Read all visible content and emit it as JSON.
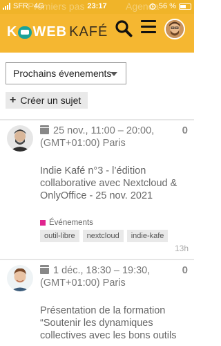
{
  "status_bar": {
    "carrier": "SFR",
    "network": "4G",
    "time": "23:17",
    "battery": "56 %",
    "battery_level": 0.56
  },
  "behind_tabs": [
    "Premiers pas",
    "Agenda"
  ],
  "header": {
    "logo_part1": "K",
    "logo_part2": "WEB",
    "logo_part3": "KAFÉ",
    "brand_color": "#f5b731"
  },
  "filter": {
    "selected": "Prochains évenements"
  },
  "create_button": {
    "label": "Créer un sujet"
  },
  "topics": [
    {
      "date": "25 nov., 11:00 – 20:00, (GMT+01:00) Paris",
      "replies": "0",
      "title": "Indie Kafé n°3 - l’édition collaborative avec Nextcloud & OnlyOffice - 25 nov. 2021",
      "category": "Événements",
      "category_color": "#e0248f",
      "tags": [
        "outil-libre",
        "nextcloud",
        "indie-kafe"
      ],
      "age": "13h"
    },
    {
      "date": "1 déc., 18:30 – 19:30, (GMT+01:00) Paris",
      "replies": "0",
      "title": "Présentation de la formation “Soutenir les dynamiques collectives avec les bons outils"
    }
  ]
}
